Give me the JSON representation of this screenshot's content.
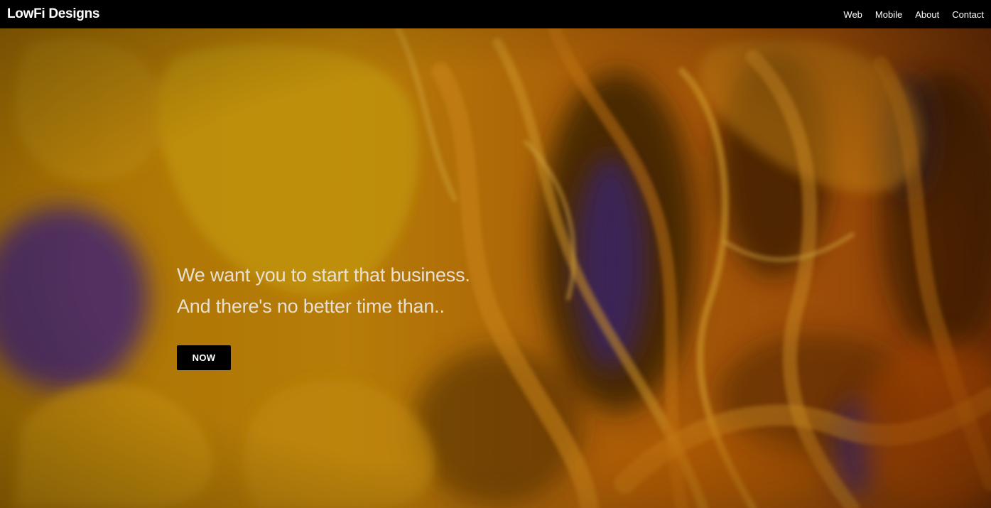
{
  "navbar": {
    "brand": "LowFi Designs",
    "links": [
      {
        "label": "Web"
      },
      {
        "label": "Mobile"
      },
      {
        "label": "About"
      },
      {
        "label": "Contact"
      }
    ]
  },
  "hero": {
    "headline_line1": "We want you to start that business.",
    "headline_line2": "And there's no better time than..",
    "cta_label": "NOW",
    "background": "orange and yellow ink smoke with purple accents"
  },
  "colors": {
    "navbar_bg": "#000000",
    "nav_text": "#ffffff",
    "hero_text": "#e8e0d0",
    "cta_bg": "#000000",
    "cta_text": "#ffffff",
    "smoke_orange": "#e07a0a",
    "smoke_yellow": "#e8b410",
    "smoke_purple": "#4a2a8a"
  }
}
